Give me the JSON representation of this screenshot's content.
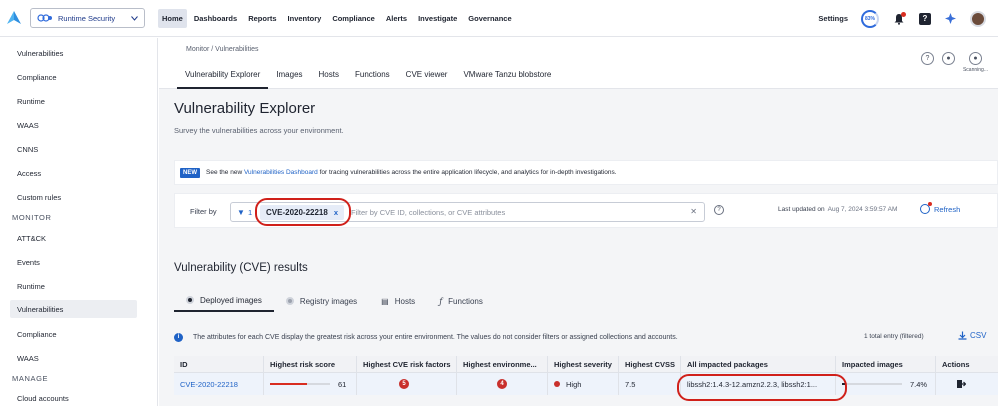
{
  "topbar": {
    "product": "Runtime Security",
    "nav": [
      "Home",
      "Dashboards",
      "Reports",
      "Inventory",
      "Compliance",
      "Alerts",
      "Investigate",
      "Governance"
    ],
    "active_nav": "Home",
    "settings": "Settings",
    "gauge": "83%"
  },
  "sidebar": {
    "items_top": [
      "Vulnerabilities",
      "Compliance",
      "Runtime",
      "WAAS",
      "CNNS",
      "Access",
      "Custom rules"
    ],
    "section_monitor": "MONITOR",
    "items_monitor": [
      "ATT&CK",
      "Events",
      "Runtime",
      "Vulnerabilities",
      "Compliance",
      "WAAS"
    ],
    "section_manage": "MANAGE",
    "items_manage": [
      "Cloud accounts"
    ]
  },
  "subheader": {
    "breadcrumb": "Monitor / Vulnerabilities",
    "tabs": [
      "Vulnerability Explorer",
      "Images",
      "Hosts",
      "Functions",
      "CVE viewer",
      "VMware Tanzu blobstore"
    ],
    "scanning": "Scanning..."
  },
  "page": {
    "title": "Vulnerability Explorer",
    "subtitle": "Survey the vulnerabilities across your environment."
  },
  "notice": {
    "badge": "NEW",
    "text_before": "See the new",
    "link": "Vulnerabilities Dashboard",
    "text_after": "for tracing vulnerabilities across the entire application lifecycle, and analytics for in-depth investigations."
  },
  "filter": {
    "label": "Filter by",
    "count": "1",
    "chip": "CVE-2020-22218",
    "chip_remove": "x",
    "placeholder": "Filter by CVE ID, collections, or CVE attributes",
    "last_updated_label": "Last updated on",
    "last_updated_value": "Aug 7, 2024 3:59:57 AM",
    "refresh": "Refresh"
  },
  "results": {
    "title": "Vulnerability (CVE) results",
    "tabs": [
      "Deployed images",
      "Registry images",
      "Hosts",
      "Functions"
    ],
    "info": "The attributes for each CVE display the greatest risk across your entire environment. The values do not consider filters or assigned collections and accounts.",
    "entries": "1 total entry (filtered)",
    "csv": "CSV"
  },
  "table": {
    "headers": [
      "ID",
      "Highest risk score",
      "Highest CVE risk factors",
      "Highest environme...",
      "Highest severity",
      "Highest CVSS",
      "All impacted packages",
      "Impacted images",
      "Actions"
    ],
    "row": {
      "id": "CVE-2020-22218",
      "risk_score": "61",
      "risk_score_fraction": 0.61,
      "risk_factors": "5",
      "environment": "4",
      "severity": "High",
      "cvss": "7.5",
      "packages": "libssh2:1.4.3-12.amzn2.2.3, libssh2:1...",
      "impacted_images": "7.4%",
      "impacted_images_fraction": 0.074
    }
  },
  "colors": {
    "accent": "#1f62c6",
    "danger": "#c9302c",
    "highlight": "#d0201a"
  }
}
